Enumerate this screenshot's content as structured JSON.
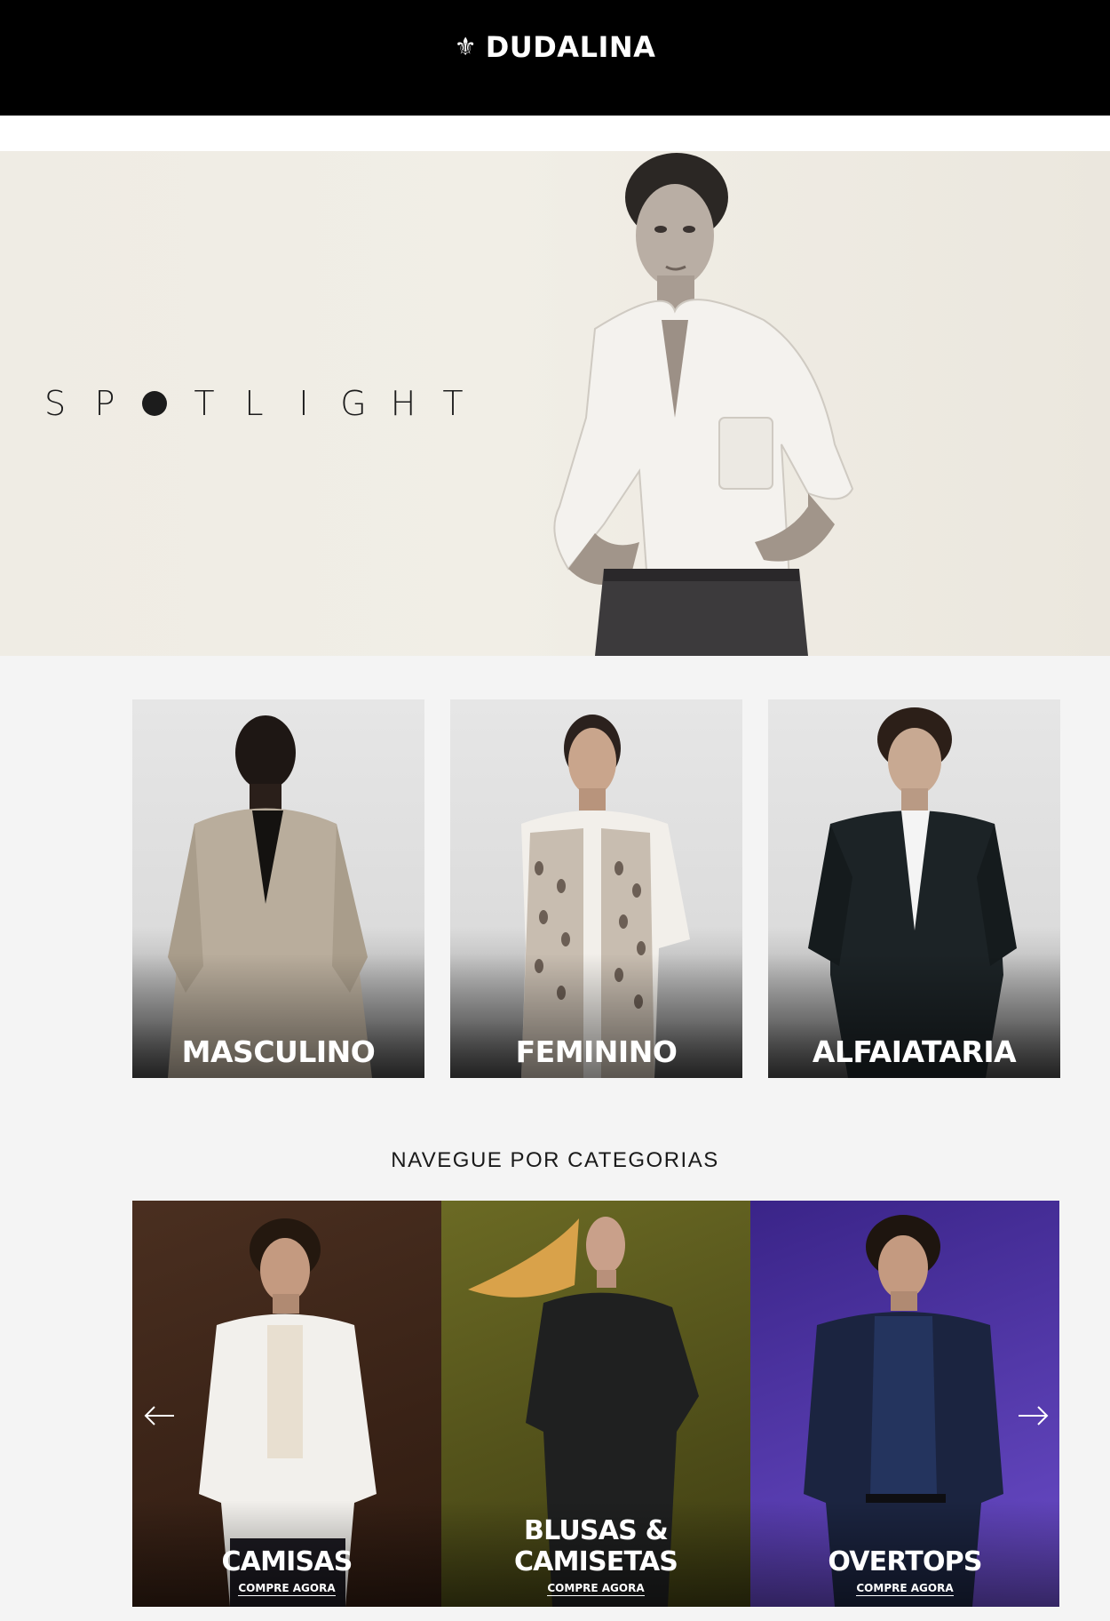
{
  "header": {
    "logo_text": "DUDALINA",
    "logo_icon": "fleur-de-lis-icon",
    "background": "#000000"
  },
  "hero": {
    "letters": [
      "S",
      "P",
      "",
      "T",
      "L",
      "I",
      "G",
      "H",
      "T"
    ],
    "campaign_word": "SPOTLIGHT",
    "background": "#efece4"
  },
  "gender_cards": [
    {
      "label": "MASCULINO"
    },
    {
      "label": "FEMININO"
    },
    {
      "label": "ALFAIATARIA"
    }
  ],
  "categories": {
    "title": "NAVEGUE POR CATEGORIAS",
    "items": [
      {
        "label": "CAMISAS",
        "cta": "COMPRE AGORA",
        "background": "#3a2418"
      },
      {
        "label": "BLUSAS & CAMISETAS",
        "cta": "COMPRE AGORA",
        "background": "#5c5a1e"
      },
      {
        "label": "OVERTOPS",
        "cta": "COMPRE AGORA",
        "background": "#4b2fa0"
      }
    ],
    "prev_icon": "arrow-left-icon",
    "next_icon": "arrow-right-icon"
  }
}
